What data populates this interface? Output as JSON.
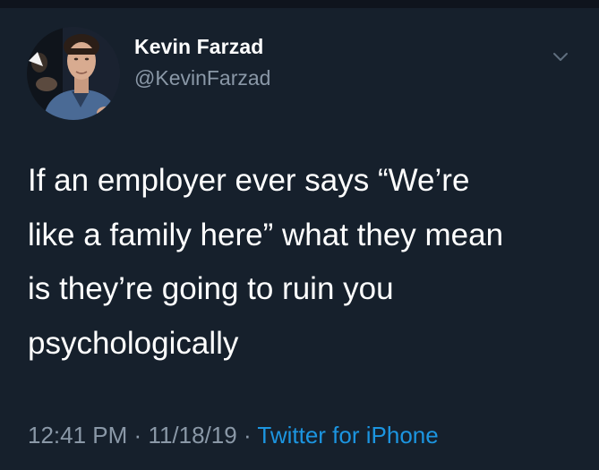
{
  "tweet": {
    "author_name": "Kevin Farzad",
    "author_handle": "@KevinFarzad",
    "text": "If an employer ever says “We’re\nlike a family here” what they mean\nis they’re going to ruin you\npsychologically",
    "time": "12:41 PM",
    "separator": "·",
    "date": "11/18/19",
    "source": "Twitter for iPhone"
  },
  "icons": {
    "menu": "chevron-down-icon"
  },
  "colors": {
    "background": "#16202c",
    "text_primary": "#ffffff",
    "text_secondary": "#8a98a7",
    "link": "#1c95e0"
  }
}
